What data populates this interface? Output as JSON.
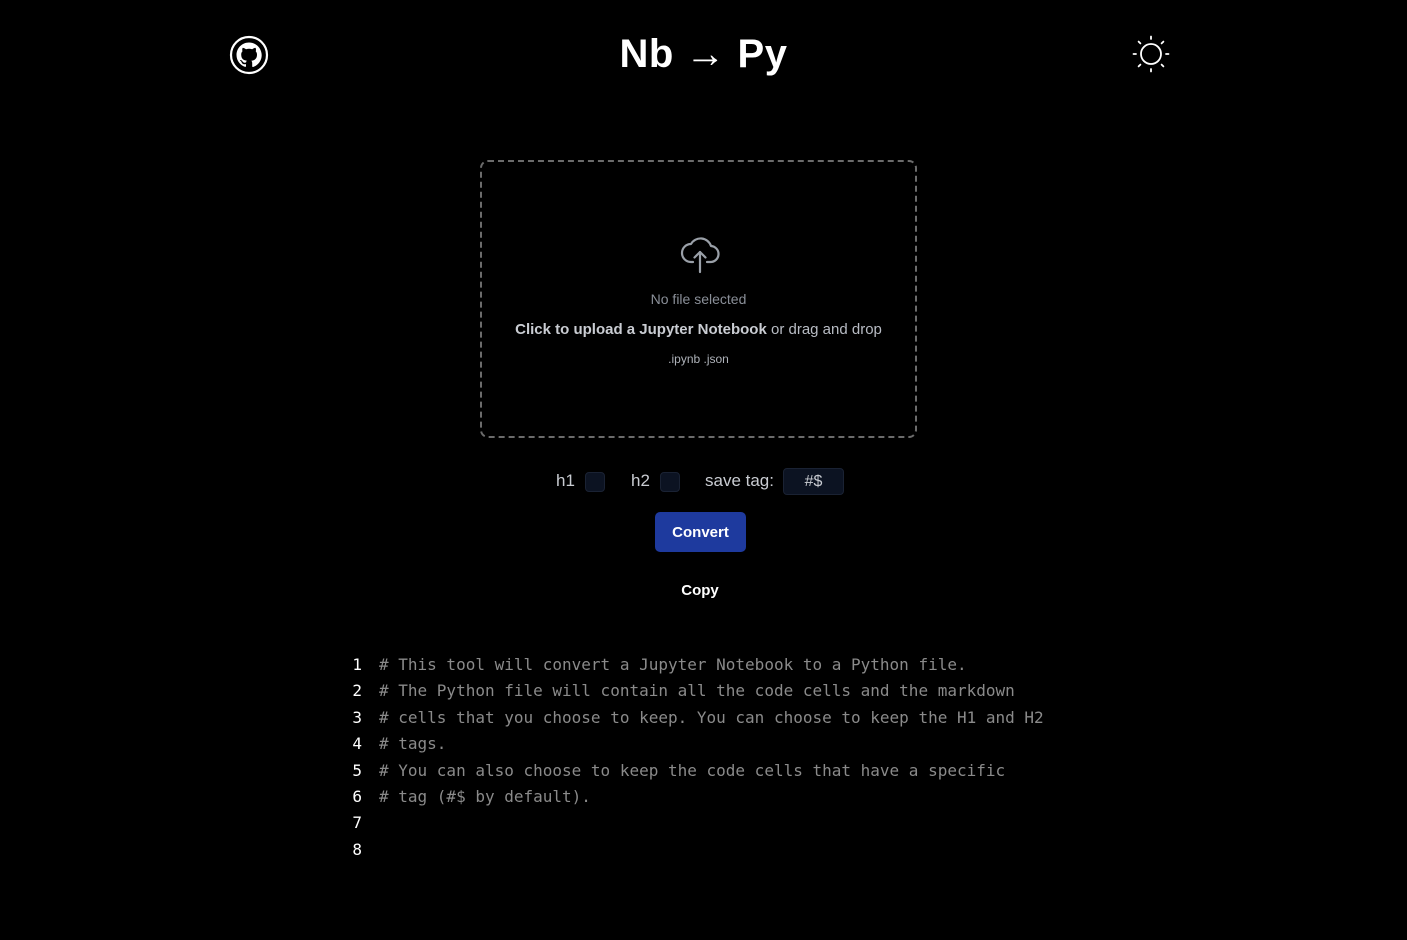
{
  "header": {
    "title": "Nb → Py",
    "github_icon": "github-icon",
    "theme_icon": "sun-icon"
  },
  "dropzone": {
    "icon": "cloud-upload-icon",
    "status": "No file selected",
    "cta_bold": "Click to upload a Jupyter Notebook",
    "cta_rest": " or drag and drop",
    "extensions": ".ipynb .json"
  },
  "options": {
    "h1_label": "h1",
    "h2_label": "h2",
    "save_tag_label": "save tag:",
    "save_tag_value": "#$"
  },
  "actions": {
    "convert_label": "Convert",
    "copy_label": "Copy"
  },
  "editor": {
    "lines": [
      {
        "num": "1",
        "text": "# This tool will convert a Jupyter Notebook to a Python file."
      },
      {
        "num": "2",
        "text": "# The Python file will contain all the code cells and the markdown"
      },
      {
        "num": "3",
        "text": "# cells that you choose to keep. You can choose to keep the H1 and H2"
      },
      {
        "num": "4",
        "text": "# tags."
      },
      {
        "num": "5",
        "text": "# You can also choose to keep the code cells that have a specific"
      },
      {
        "num": "6",
        "text": "# tag (#$ by default)."
      },
      {
        "num": "7",
        "text": ""
      },
      {
        "num": "8",
        "text": ""
      }
    ]
  },
  "colors": {
    "background": "#000000",
    "accent": "#1e3a9e",
    "muted_text": "#8a8a8a"
  }
}
